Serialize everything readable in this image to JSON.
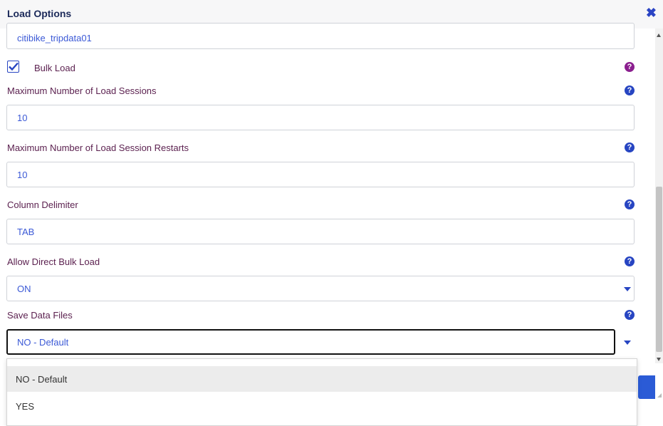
{
  "dialog": {
    "title": "Load Options",
    "close_icon": "close-x-icon"
  },
  "table_name": {
    "value": "citibike_tripdata01"
  },
  "bulk_load": {
    "label": "Bulk Load",
    "checked": true
  },
  "max_sessions": {
    "label": "Maximum Number of Load Sessions",
    "value": "10"
  },
  "max_restarts": {
    "label": "Maximum Number of Load Session Restarts",
    "value": "10"
  },
  "column_delimiter": {
    "label": "Column Delimiter",
    "value": "TAB"
  },
  "allow_direct_bulk": {
    "label": "Allow Direct Bulk Load",
    "value": "ON"
  },
  "save_data_files": {
    "label": "Save Data Files",
    "value": "NO - Default",
    "options": [
      "NO - Default",
      "YES"
    ],
    "highlighted_option": "NO - Default"
  },
  "help_icon_glyph": "?",
  "colors": {
    "accent": "#2745c2",
    "value_text": "#3b59d6",
    "label_text": "#5a1f4e",
    "help_purple": "#8b1f8f"
  }
}
